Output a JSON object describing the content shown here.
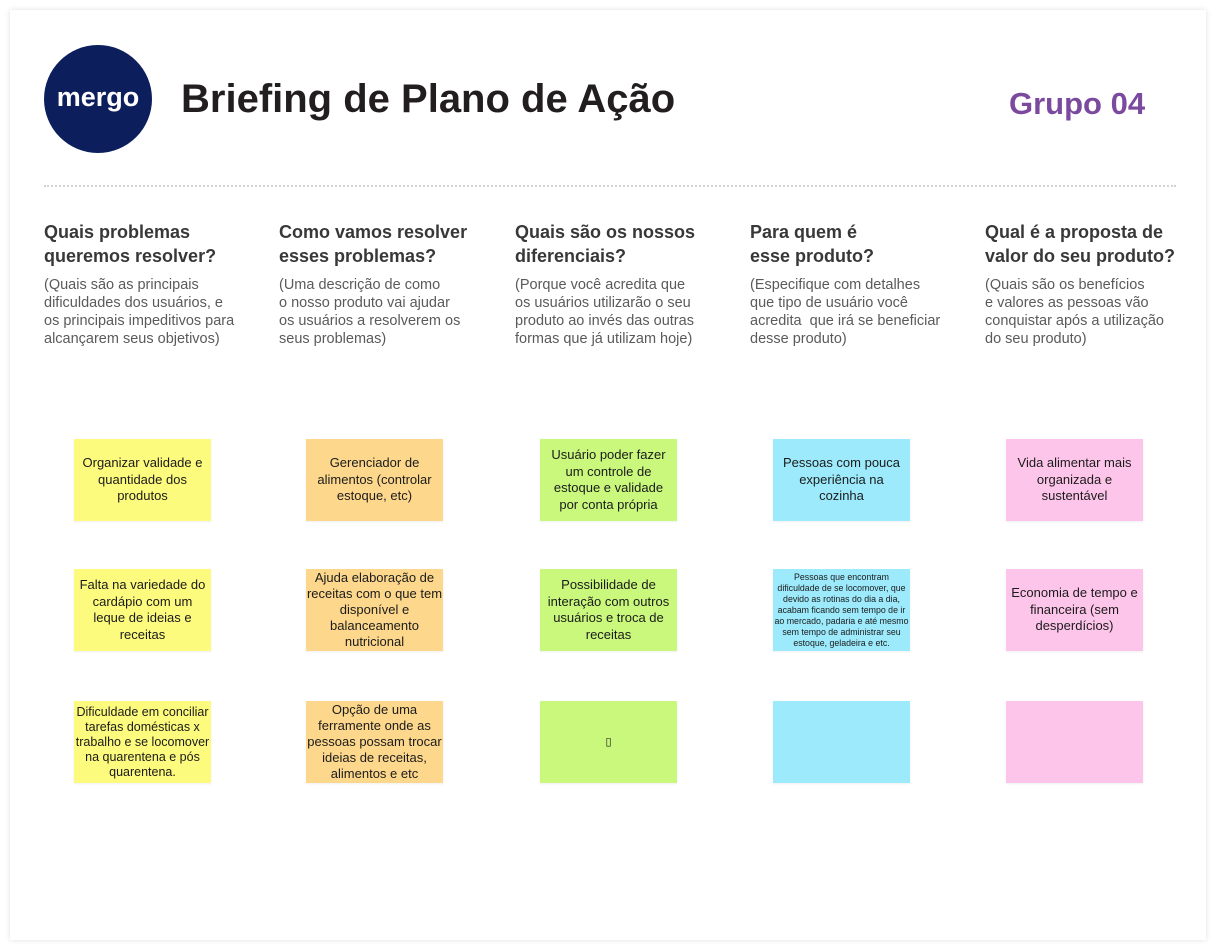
{
  "header": {
    "logo_text": "mergo",
    "logo_color": "#0c1f5c",
    "title": "Briefing de Plano de Ação",
    "group": "Grupo 04",
    "group_color": "#7b4a9e"
  },
  "columns": [
    {
      "heading": "Quais problemas\nqueremos resolver?",
      "description": "(Quais são as principais\ndificuldades dos usuários, e\nos principais impeditivos para\nalcançarem seus objetivos)",
      "note_color": "#fdfb7d",
      "notes": [
        "Organizar validade e\nquantidade dos\nprodutos",
        "Falta na variedade do\ncardápio com um\nleque de ideias e\nreceitas",
        "Dificuldade em conciliar\ntarefas domésticas x\ntrabalho e se locomover\nna quarentena e pós\nquarentena."
      ]
    },
    {
      "heading": "Como vamos resolver\nesses problemas?",
      "description": "(Uma descrição de como\no nosso produto vai ajudar\nos usuários a resolverem os\nseus problemas)",
      "note_color": "#fdd88c",
      "notes": [
        "Gerenciador de\nalimentos (controlar\nestoque, etc)",
        "Ajuda elaboração de\nreceitas com o que tem\ndisponível e\nbalanceamento\nnutricional",
        "Opção de uma\nferramente onde as\npessoas possam trocar\nideias de receitas,\nalimentos e etc"
      ]
    },
    {
      "heading": "Quais são os nossos\ndiferenciais?",
      "description": "(Porque você acredita que\nos usuários utilizarão o seu\nproduto ao invés das outras\nformas que já utilizam hoje)",
      "note_color": "#c9f87c",
      "notes": [
        "Usuário poder fazer\num controle de\nestoque e validade\npor conta própria",
        "Possibilidade de\ninteração com outros\nusuários e troca de\nreceitas",
        "▯"
      ]
    },
    {
      "heading": "Para quem é\nesse produto?",
      "description": "(Especifique com detalhes\nque tipo de usuário você\nacredita  que irá se beneficiar\ndesse produto)",
      "note_color": "#9ceafb",
      "notes": [
        "Pessoas com pouca\nexperiência na\ncozinha",
        "Pessoas que encontram\ndificuldade de se locomover, que\ndevido as rotinas do dia a dia,\nacabam ficando sem tempo de ir\nao mercado, padaria e até mesmo\nsem tempo de administrar seu\nestoque, geladeira e etc.",
        ""
      ]
    },
    {
      "heading": "Qual é a proposta de\nvalor do seu produto?",
      "description": "(Quais são os benefícios\ne valores as pessoas vão\nconquistar após a utilização\ndo seu produto)",
      "note_color": "#fec5ea",
      "notes": [
        "Vida alimentar mais\norganizada e\nsustentável",
        "Economia de tempo e\nfinanceira (sem\ndesperdícios)",
        ""
      ]
    }
  ]
}
